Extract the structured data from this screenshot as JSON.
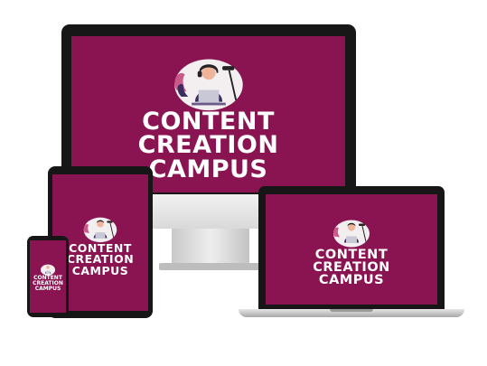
{
  "brand": {
    "line1": "CONTENT",
    "line2": "CREATION",
    "line3": "CAMPUS"
  },
  "colors": {
    "screen_background": "#8a1452",
    "device_bezel": "#171717",
    "text": "#ffffff"
  },
  "icons": {
    "illustration": "podcaster-with-microphone-illustration"
  }
}
